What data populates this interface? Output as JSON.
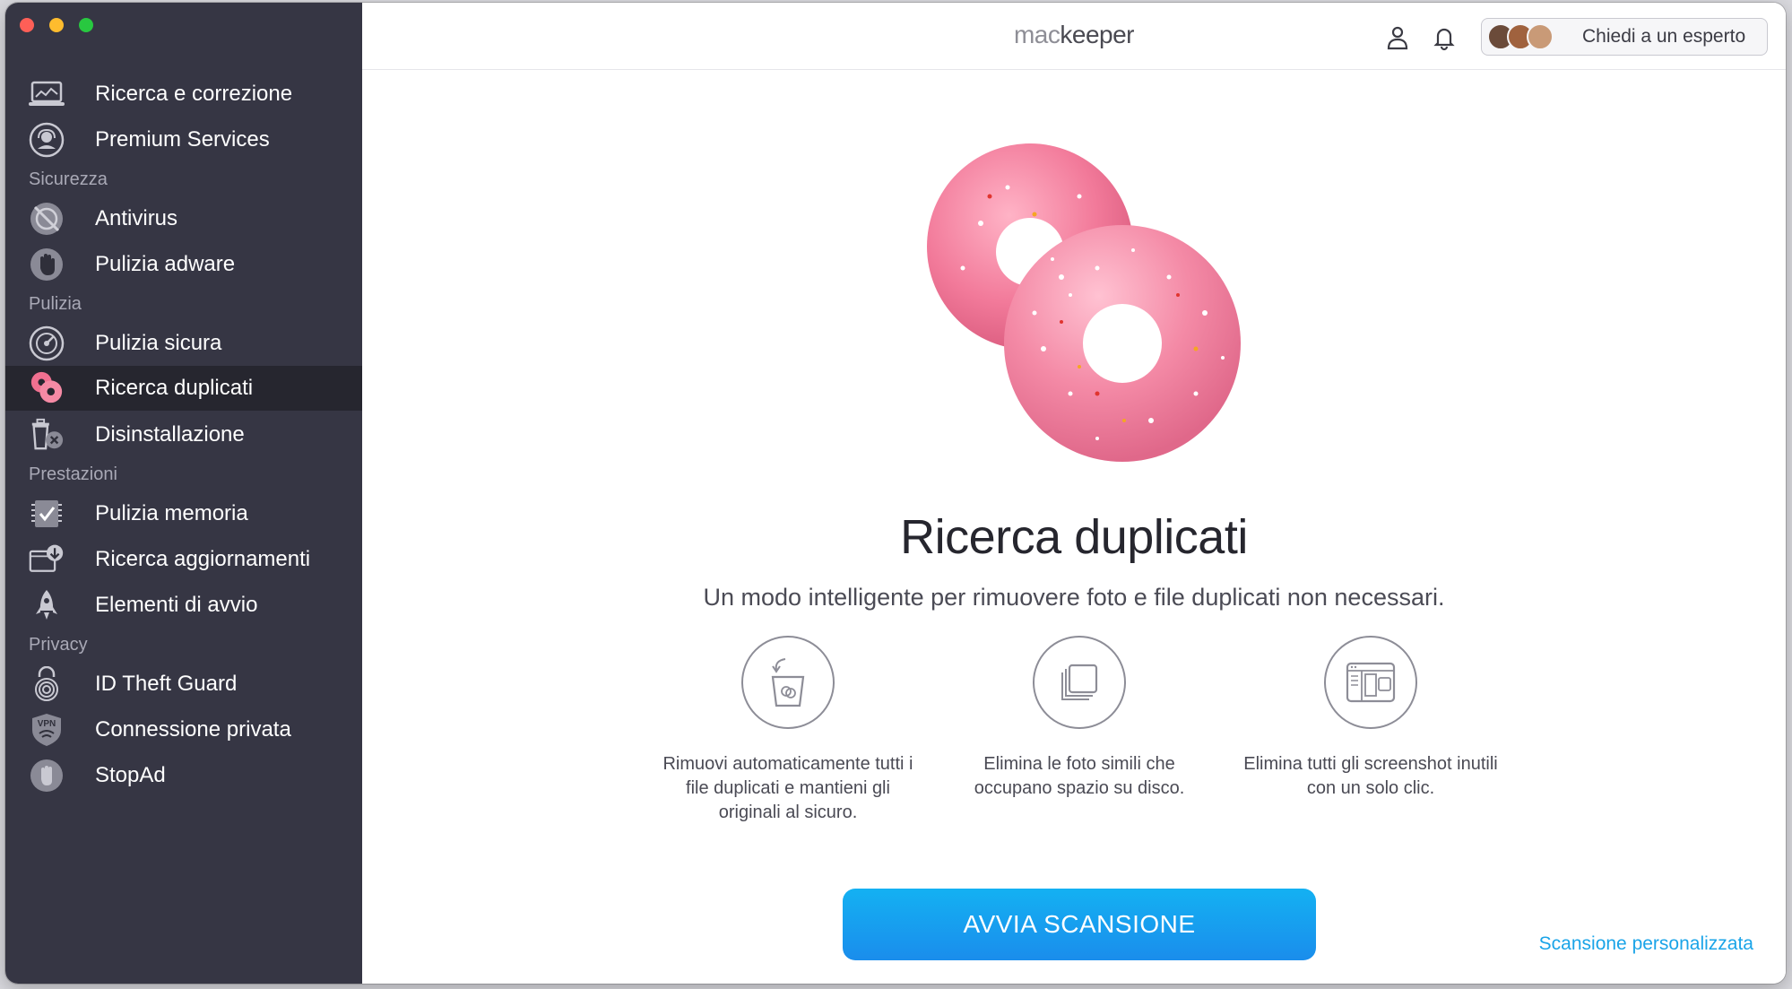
{
  "app": {
    "brand_light": "mac",
    "brand_dark": "keeper"
  },
  "sidebar": {
    "items": [
      {
        "label": "Ricerca e correzione",
        "icon": "laptop-chart-icon"
      },
      {
        "label": "Premium Services",
        "icon": "headset-icon"
      },
      {
        "label": "Antivirus",
        "icon": "shield-off-icon"
      },
      {
        "label": "Pulizia adware",
        "icon": "hand-icon"
      },
      {
        "label": "Pulizia sicura",
        "icon": "disk-clean-icon"
      },
      {
        "label": "Ricerca duplicati",
        "icon": "duplicates-icon",
        "active": true
      },
      {
        "label": "Disinstallazione",
        "icon": "trash-x-icon"
      },
      {
        "label": "Pulizia memoria",
        "icon": "memory-check-icon"
      },
      {
        "label": "Ricerca aggiornamenti",
        "icon": "update-download-icon"
      },
      {
        "label": "Elementi di avvio",
        "icon": "rocket-icon"
      },
      {
        "label": "ID Theft Guard",
        "icon": "fingerprint-icon"
      },
      {
        "label": "Connessione privata",
        "icon": "vpn-icon"
      },
      {
        "label": "StopAd",
        "icon": "stop-hand-icon"
      }
    ],
    "sections": [
      "Sicurezza",
      "Pulizia",
      "Prestazioni",
      "Privacy"
    ]
  },
  "header": {
    "expert_button": "Chiedi a un esperto"
  },
  "main": {
    "title": "Ricerca duplicati",
    "subtitle": "Un modo intelligente per rimuovere foto e file duplicati non necessari.",
    "features": [
      {
        "icon": "trash-bin-icon",
        "text": "Rimuovi automaticamente tutti i file duplicati e mantieni gli originali al sicuro."
      },
      {
        "icon": "similar-photos-icon",
        "text": "Elimina le foto simili che occupano spazio su disco."
      },
      {
        "icon": "screenshot-icon",
        "text": "Elimina tutti gli screenshot inutili con un solo clic."
      }
    ],
    "scan_button": "AVVIA SCANSIONE",
    "custom_scan_link": "Scansione personalizzata"
  },
  "colors": {
    "sidebar_bg": "#363644",
    "sidebar_active": "#26262f",
    "accent": "#1a8dec",
    "link": "#1aa4e8",
    "donut": "#f27a9a"
  }
}
